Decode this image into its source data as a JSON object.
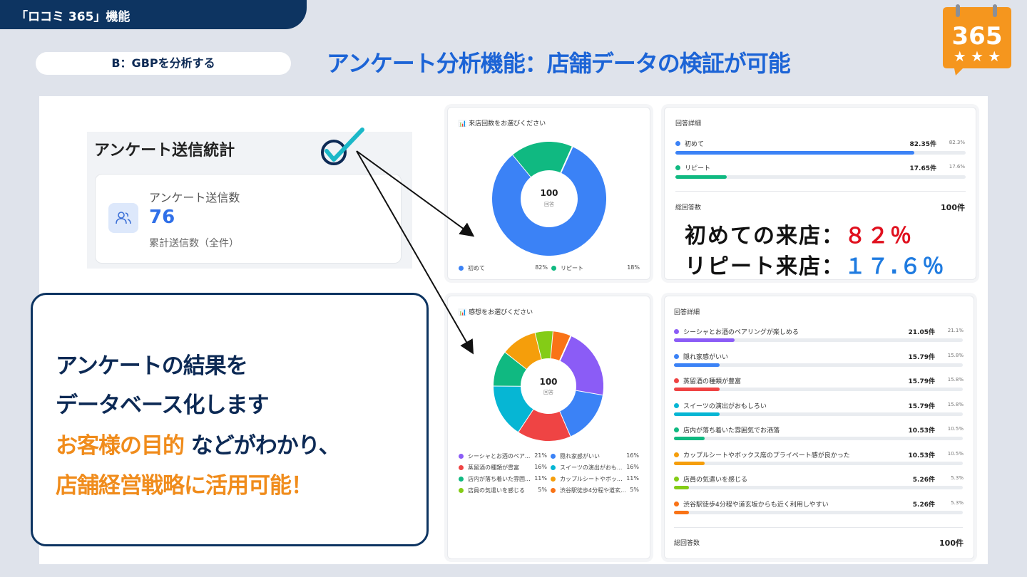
{
  "header": {
    "tag": "「ロコミ 365」機能",
    "pill": "B：GBPを分析する",
    "headline": "アンケート分析機能：店舗データの検証が可能"
  },
  "logo": {
    "text": "365",
    "brand_color": "#f5961e"
  },
  "stats": {
    "title": "アンケート送信統計",
    "label": "アンケート送信数",
    "value": "76",
    "sub": "累計送信数（全件）"
  },
  "visit_chart": {
    "title": "来店回数をお選びください",
    "center_value": "100",
    "center_label": "回答",
    "legend": [
      {
        "label": "初めて",
        "pct": "82%",
        "color": "#3b82f6"
      },
      {
        "label": "リピート",
        "pct": "18%",
        "color": "#10b981"
      }
    ]
  },
  "visit_detail": {
    "title": "回答詳細",
    "rows": [
      {
        "label": "初めて",
        "value": "82.35件",
        "pct": "82.3%",
        "color": "#3b82f6",
        "ratio": 0.823
      },
      {
        "label": "リピート",
        "value": "17.65件",
        "pct": "17.6%",
        "color": "#10b981",
        "ratio": 0.176
      }
    ],
    "total_label": "総回答数",
    "total_value": "100件",
    "callout_first_label": "初めての来店：",
    "callout_first_value": "８２％",
    "callout_repeat_label": "リピート来店：",
    "callout_repeat_value": "１７.６％"
  },
  "impression_chart": {
    "title": "感想をお選びください",
    "center_value": "100",
    "center_label": "回答",
    "legend": [
      {
        "label": "シーシャとお酒のペア...",
        "pct": "21%",
        "color": "#8b5cf6"
      },
      {
        "label": "隠れ家感がいい",
        "pct": "16%",
        "color": "#3b82f6"
      },
      {
        "label": "蒸留酒の種類が豊富",
        "pct": "16%",
        "color": "#ef4444"
      },
      {
        "label": "スイーツの演出がおも...",
        "pct": "16%",
        "color": "#06b6d4"
      },
      {
        "label": "店内が落ち着いた雰囲...",
        "pct": "11%",
        "color": "#10b981"
      },
      {
        "label": "カップルシートやボッ...",
        "pct": "11%",
        "color": "#f59e0b"
      },
      {
        "label": "店員の気遣いを感じる",
        "pct": "5%",
        "color": "#84cc16"
      },
      {
        "label": "渋谷駅徒歩4分程や道玄...",
        "pct": "5%",
        "color": "#f97316"
      }
    ]
  },
  "impression_detail": {
    "title": "回答詳細",
    "rows": [
      {
        "label": "シーシャとお酒のペアリングが楽しめる",
        "value": "21.05件",
        "pct": "21.1%",
        "color": "#8b5cf6",
        "ratio": 0.211
      },
      {
        "label": "隠れ家感がいい",
        "value": "15.79件",
        "pct": "15.8%",
        "color": "#3b82f6",
        "ratio": 0.158
      },
      {
        "label": "蒸留酒の種類が豊富",
        "value": "15.79件",
        "pct": "15.8%",
        "color": "#ef4444",
        "ratio": 0.158
      },
      {
        "label": "スイーツの演出がおもしろい",
        "value": "15.79件",
        "pct": "15.8%",
        "color": "#06b6d4",
        "ratio": 0.158
      },
      {
        "label": "店内が落ち着いた雰囲気でお洒落",
        "value": "10.53件",
        "pct": "10.5%",
        "color": "#10b981",
        "ratio": 0.105
      },
      {
        "label": "カップルシートやボックス席のプライベート感が良かった",
        "value": "10.53件",
        "pct": "10.5%",
        "color": "#f59e0b",
        "ratio": 0.105
      },
      {
        "label": "店員の気遣いを感じる",
        "value": "5.26件",
        "pct": "5.3%",
        "color": "#84cc16",
        "ratio": 0.053
      },
      {
        "label": "渋谷駅徒歩4分程や道玄坂からも近く利用しやすい",
        "value": "5.26件",
        "pct": "5.3%",
        "color": "#f97316",
        "ratio": 0.053
      }
    ],
    "total_label": "総回答数",
    "total_value": "100件"
  },
  "message": {
    "line1": "アンケートの結果を",
    "line2": "データベース化します",
    "line3_accent": "お客様の目的",
    "line3_rest": "などがわかり、",
    "line4": "店舗経営戦略に活用可能！"
  },
  "chart_data": [
    {
      "type": "pie",
      "title": "来店回数をお選びください",
      "categories": [
        "初めて",
        "リピート"
      ],
      "values": [
        82.35,
        17.65
      ]
    },
    {
      "type": "pie",
      "title": "感想をお選びください",
      "categories": [
        "シーシャとお酒のペアリングが楽しめる",
        "隠れ家感がいい",
        "蒸留酒の種類が豊富",
        "スイーツの演出がおもしろい",
        "店内が落ち着いた雰囲気でお洒落",
        "カップルシートやボックス席のプライベート感が良かった",
        "店員の気遣いを感じる",
        "渋谷駅徒歩4分程や道玄坂からも近く利用しやすい"
      ],
      "values": [
        21.05,
        15.79,
        15.79,
        15.79,
        10.53,
        10.53,
        5.26,
        5.26
      ]
    }
  ]
}
